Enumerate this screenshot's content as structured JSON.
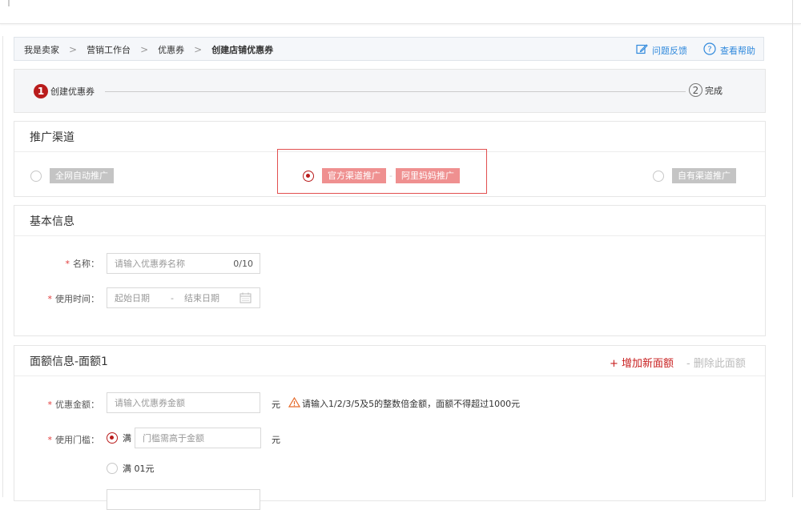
{
  "breadcrumb": {
    "items": [
      "我是卖家",
      "营销工作台",
      "优惠券",
      "创建店铺优惠券"
    ],
    "separator": ">",
    "feedback": "问题反馈",
    "help": "查看帮助"
  },
  "steps": {
    "step1_num": "1",
    "step1_label": "创建优惠券",
    "step2_num": "2",
    "step2_label": "完成"
  },
  "channel": {
    "title": "推广渠道",
    "option_all": "全网自动推广",
    "option_official": "官方渠道推广",
    "dash": "-",
    "option_alimama": "阿里妈妈推广",
    "option_own": "自有渠道推广",
    "selected": "official"
  },
  "basic": {
    "title": "基本信息",
    "name_label": "名称：",
    "name_placeholder": "请输入优惠券名称",
    "name_count": "0/10",
    "time_label": "使用时间：",
    "start_placeholder": "起始日期",
    "date_sep": "-",
    "end_placeholder": "结束日期"
  },
  "amount": {
    "title": "面额信息-面额1",
    "add_label": "+ 增加新面额",
    "delete_label": "- 删除此面额",
    "discount_label": "优惠金额：",
    "discount_placeholder": "请输入优惠券金额",
    "unit": "元",
    "warning": "请输入1/2/3/5及5的整数倍金额，面额不得超过1000元",
    "threshold_label": "使用门槛：",
    "full_label": "满",
    "threshold_placeholder": "门槛需高于金额",
    "full_01": "满 01元"
  },
  "colors": {
    "brand_red": "#b91c1c",
    "link_blue": "#3089dc",
    "pink_tag": "#ef9090"
  }
}
